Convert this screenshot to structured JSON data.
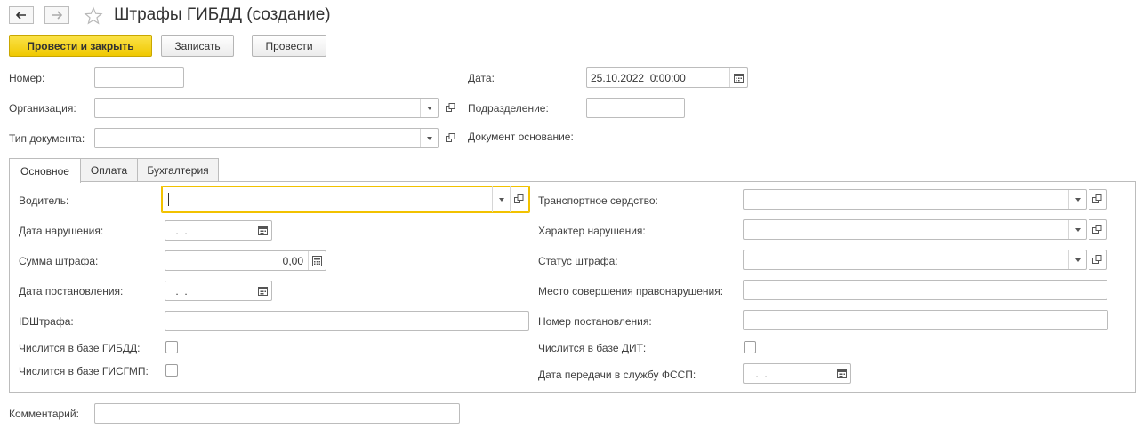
{
  "window": {
    "title": "Штрафы ГИБДД (создание)",
    "back_icon": "arrow-left-icon",
    "forward_icon": "arrow-right-icon",
    "favorite_icon": "star-icon"
  },
  "toolbar": {
    "post_close_label": "Провести и закрыть",
    "save_label": "Записать",
    "post_label": "Провести",
    "accent_color": "#f5d31b"
  },
  "header": {
    "number_label": "Номер:",
    "number_value": "",
    "date_label": "Дата:",
    "date_value": "25.10.2022  0:00:00",
    "organization_label": "Организация:",
    "organization_value": "",
    "department_label": "Подразделение:",
    "department_value": "",
    "doc_type_label": "Тип документа:",
    "doc_type_value": "",
    "base_doc_label": "Документ основание:"
  },
  "tabs": [
    {
      "label": "Основное",
      "active": true
    },
    {
      "label": "Оплата",
      "active": false
    },
    {
      "label": "Бухгалтерия",
      "active": false
    }
  ],
  "main": {
    "driver_label": "Водитель:",
    "driver_value": "",
    "violation_date_label": "Дата нарушения:",
    "violation_date_value": " .  .",
    "fine_amount_label": "Сумма штрафа:",
    "fine_amount_value": "0,00",
    "resolution_date_label": "Дата постановления:",
    "resolution_date_value": " .  .",
    "fine_id_label": "IDШтрафа:",
    "fine_id_value": "",
    "in_gibdd_label": "Числится в базе ГИБДД:",
    "in_gibdd_checked": false,
    "in_gisgmp_label": "Числится в базе ГИСГМП:",
    "in_gisgmp_checked": false,
    "vehicle_label": "Транспортное сердство:",
    "vehicle_value": "",
    "violation_type_label": "Характер нарушения:",
    "violation_type_value": "",
    "fine_status_label": "Статус штрафа:",
    "fine_status_value": "",
    "violation_place_label": "Место совершения правонарушения:",
    "violation_place_value": "",
    "resolution_number_label": "Номер постановления:",
    "resolution_number_value": "",
    "in_dit_label": "Числится в базе ДИТ:",
    "in_dit_checked": false,
    "fssp_date_label": "Дата передачи в службу ФССП:",
    "fssp_date_value": " .  ."
  },
  "footer": {
    "comment_label": "Комментарий:",
    "comment_value": ""
  }
}
